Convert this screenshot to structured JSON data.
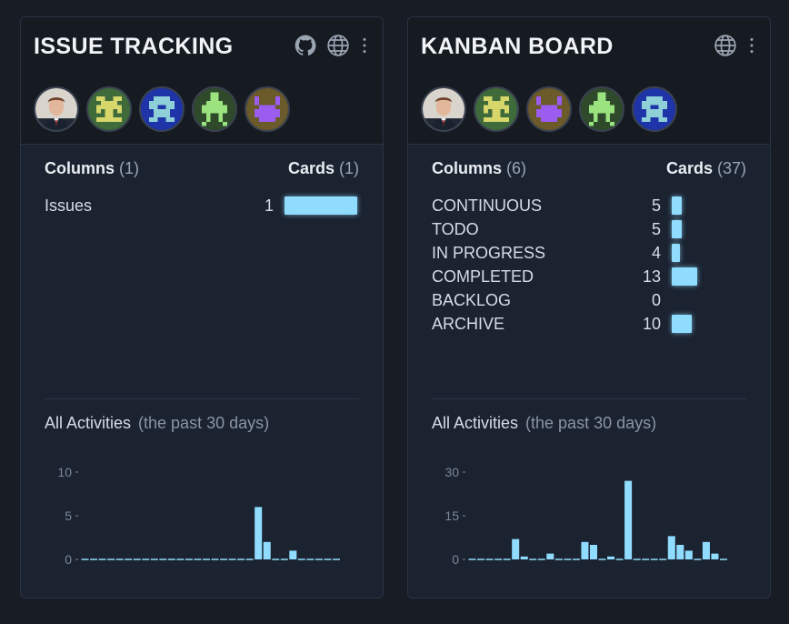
{
  "colors": {
    "background": "#181c24",
    "card": "#1b2230",
    "bar": "#8fdcff",
    "muted": "#8a95a5"
  },
  "boards": [
    {
      "title": "ISSUE TRACKING",
      "icons": [
        "github-icon",
        "globe-icon",
        "kebab-menu-icon"
      ],
      "members": [
        "avatar-photo",
        "avatar-pixel-yellow",
        "avatar-pixel-blue",
        "avatar-pixel-green",
        "avatar-pixel-purple"
      ],
      "columns_label": "Columns",
      "columns_count": "(1)",
      "cards_label": "Cards",
      "cards_count": "(1)",
      "columns": [
        {
          "name": "Issues",
          "count": "1",
          "value": 1
        }
      ],
      "activity_title": "All Activities",
      "activity_period": "(the past 30 days)",
      "chart_data": {
        "type": "bar",
        "title": "All Activities",
        "xlabel": "",
        "ylabel": "",
        "ylim": [
          0,
          10
        ],
        "yticks": [
          "10",
          "5",
          "0"
        ],
        "ytick_values": [
          10,
          5,
          0
        ],
        "values": [
          0,
          0,
          0,
          0,
          0,
          0,
          0,
          0,
          0,
          0,
          0,
          0,
          0,
          0,
          0,
          0,
          0,
          0,
          0,
          0,
          6,
          2,
          0,
          0,
          1,
          0,
          0,
          0,
          0,
          0
        ]
      }
    },
    {
      "title": "KANBAN BOARD",
      "icons": [
        "globe-icon",
        "kebab-menu-icon"
      ],
      "members": [
        "avatar-photo",
        "avatar-pixel-yellow",
        "avatar-pixel-purple",
        "avatar-pixel-green",
        "avatar-pixel-blue"
      ],
      "columns_label": "Columns",
      "columns_count": "(6)",
      "cards_label": "Cards",
      "cards_count": "(37)",
      "columns": [
        {
          "name": "CONTINUOUS",
          "count": "5",
          "value": 5
        },
        {
          "name": "TODO",
          "count": "5",
          "value": 5
        },
        {
          "name": "IN PROGRESS",
          "count": "4",
          "value": 4
        },
        {
          "name": "COMPLETED",
          "count": "13",
          "value": 13
        },
        {
          "name": "BACKLOG",
          "count": "0",
          "value": 0
        },
        {
          "name": "ARCHIVE",
          "count": "10",
          "value": 10
        }
      ],
      "activity_title": "All Activities",
      "activity_period": "(the past 30 days)",
      "chart_data": {
        "type": "bar",
        "title": "All Activities",
        "xlabel": "",
        "ylabel": "",
        "ylim": [
          0,
          30
        ],
        "yticks": [
          "30",
          "15",
          "0"
        ],
        "ytick_values": [
          30,
          15,
          0
        ],
        "values": [
          0,
          0,
          0,
          0,
          0,
          7,
          1,
          0,
          0,
          2,
          0,
          0,
          0,
          6,
          5,
          0,
          1,
          0,
          27,
          0,
          0,
          0,
          0,
          8,
          5,
          3,
          0,
          6,
          2,
          0
        ]
      }
    }
  ]
}
